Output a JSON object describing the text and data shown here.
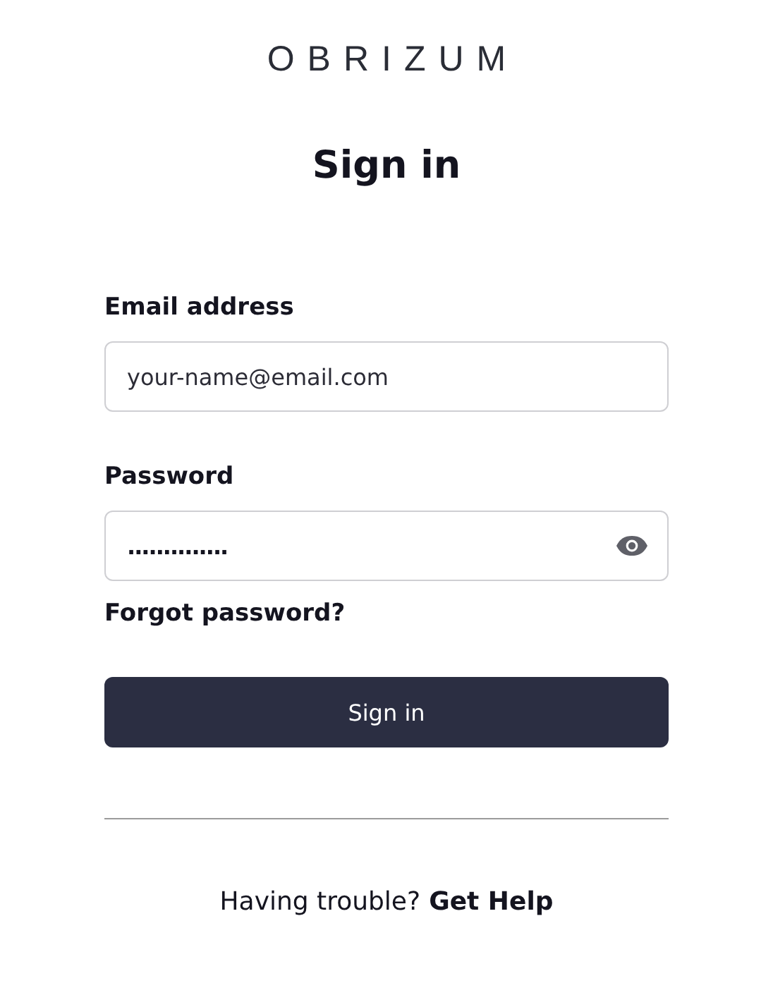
{
  "logo": "OBRIZUM",
  "title": "Sign in",
  "fields": [
    {
      "kind": "email",
      "label": "Email address",
      "placeholder": "your-name@email.com"
    },
    {
      "kind": "password",
      "label": "Password",
      "value": "..............",
      "reveal_toggle": true
    }
  ],
  "forgot_link": "Forgot password?",
  "submit_button": "Sign in",
  "help": {
    "text": "Having trouble?",
    "link": "Get Help"
  }
}
